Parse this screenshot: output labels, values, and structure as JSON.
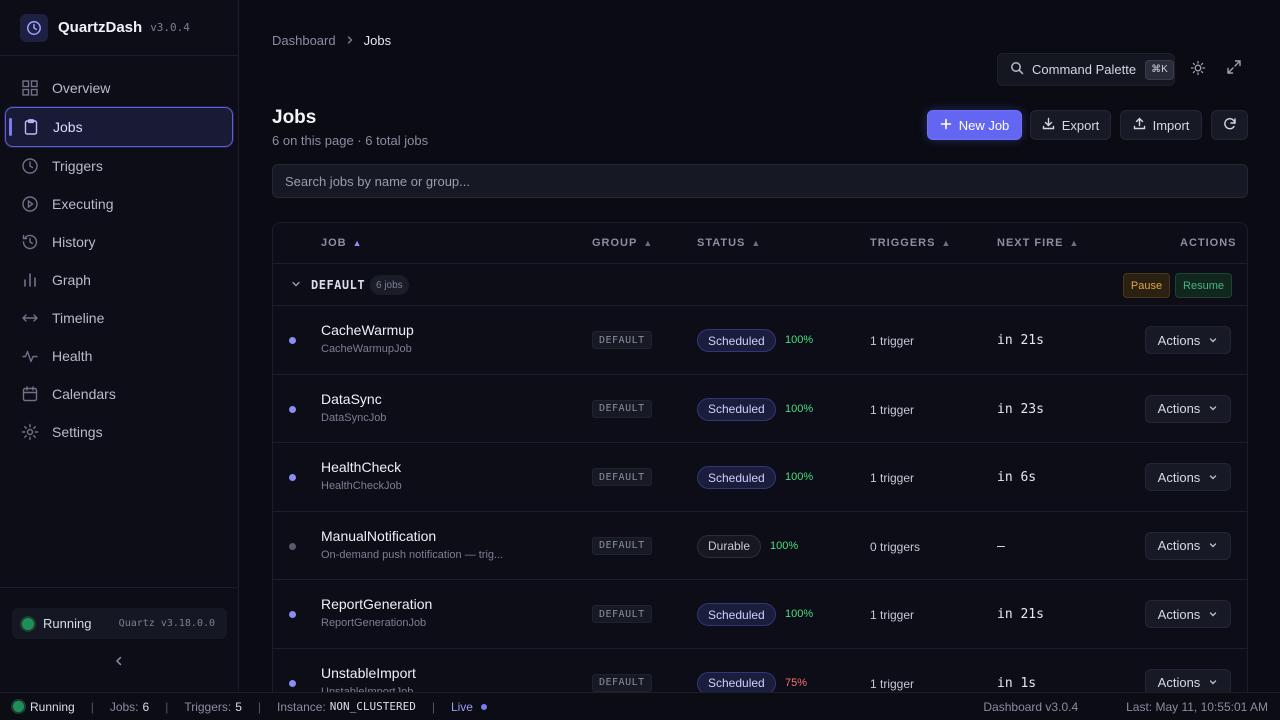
{
  "brand": {
    "name": "QuartzDash",
    "version": "v3.0.4"
  },
  "sidebar": {
    "items": [
      {
        "label": "Overview",
        "icon": "grid-icon"
      },
      {
        "label": "Jobs",
        "icon": "clipboard-icon",
        "active": true
      },
      {
        "label": "Triggers",
        "icon": "clock-icon"
      },
      {
        "label": "Executing",
        "icon": "play-circle-icon"
      },
      {
        "label": "History",
        "icon": "history-icon"
      },
      {
        "label": "Graph",
        "icon": "bar-chart-icon"
      },
      {
        "label": "Timeline",
        "icon": "arrows-horizontal-icon"
      },
      {
        "label": "Health",
        "icon": "activity-icon"
      },
      {
        "label": "Calendars",
        "icon": "calendar-icon"
      },
      {
        "label": "Settings",
        "icon": "gear-icon"
      }
    ],
    "status": {
      "label": "Running",
      "quartz_version": "Quartz v3.18.0.0"
    }
  },
  "breadcrumb": {
    "root": "Dashboard",
    "current": "Jobs"
  },
  "toolbar": {
    "command_palette": "Command Palette",
    "shortcut": "⌘K"
  },
  "page": {
    "title": "Jobs",
    "subtitle": "6 on this page · 6 total jobs"
  },
  "actions": {
    "new_job": "New Job",
    "export": "Export",
    "import": "Import"
  },
  "search": {
    "placeholder": "Search jobs by name or group..."
  },
  "table": {
    "columns": {
      "job": "JOB",
      "group": "GROUP",
      "status": "STATUS",
      "triggers": "TRIGGERS",
      "next_fire": "NEXT FIRE",
      "actions": "ACTIONS"
    },
    "group": {
      "name": "DEFAULT",
      "count": "6 jobs",
      "pause": "Pause",
      "resume": "Resume"
    },
    "rows": [
      {
        "name": "CacheWarmup",
        "class": "CacheWarmupJob",
        "group": "DEFAULT",
        "status": "Scheduled",
        "pct": "100%",
        "triggers": "1 trigger",
        "next_fire": "in 21s",
        "action": "Actions"
      },
      {
        "name": "DataSync",
        "class": "DataSyncJob",
        "group": "DEFAULT",
        "status": "Scheduled",
        "pct": "100%",
        "triggers": "1 trigger",
        "next_fire": "in 23s",
        "action": "Actions"
      },
      {
        "name": "HealthCheck",
        "class": "HealthCheckJob",
        "group": "DEFAULT",
        "status": "Scheduled",
        "pct": "100%",
        "triggers": "1 trigger",
        "next_fire": "in 6s",
        "action": "Actions"
      },
      {
        "name": "ManualNotification",
        "class": "On-demand push notification — trig...",
        "group": "DEFAULT",
        "status": "Durable",
        "pct": "100%",
        "triggers": "0 triggers",
        "next_fire": "—",
        "action": "Actions"
      },
      {
        "name": "ReportGeneration",
        "class": "ReportGenerationJob",
        "group": "DEFAULT",
        "status": "Scheduled",
        "pct": "100%",
        "triggers": "1 trigger",
        "next_fire": "in 21s",
        "action": "Actions"
      },
      {
        "name": "UnstableImport",
        "class": "UnstableImportJob",
        "group": "DEFAULT",
        "status": "Scheduled",
        "pct": "75%",
        "triggers": "1 trigger",
        "next_fire": "in 1s",
        "action": "Actions"
      }
    ]
  },
  "statusbar": {
    "running": "Running",
    "jobs_label": "Jobs:",
    "jobs": "6",
    "triggers_label": "Triggers:",
    "triggers": "5",
    "instance_label": "Instance:",
    "instance": "NON_CLUSTERED",
    "live": "Live",
    "dashboard_version": "Dashboard v3.0.4",
    "last_updated": "Last: May 11, 10:55:01 AM"
  },
  "colors": {
    "accent": "#6366f1",
    "success": "#4ade80",
    "warning": "#e0a54a",
    "danger": "#f87171"
  }
}
